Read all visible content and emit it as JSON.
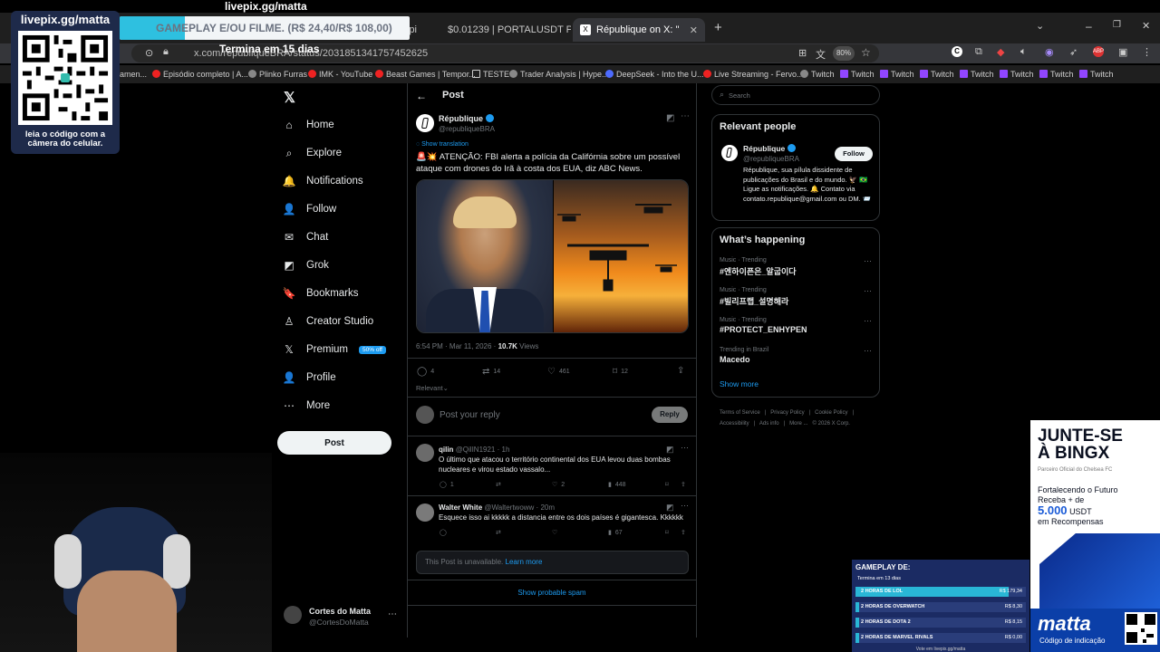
{
  "browser": {
    "tabs": [
      {
        "label": "Epi",
        "active": false
      },
      {
        "label": "$0.01239 | PORTALUSDT Perpé",
        "active": false
      },
      {
        "label": "République on X: \"",
        "active": true
      }
    ],
    "url": "x.com/republiqueBRA/status/2031851341757452625",
    "zoom": "80%",
    "bookmarks": [
      "amen...",
      "Episódio completo | A...",
      "Plinko Furras",
      "IMK - YouTube",
      "Beast Games | Tempor...",
      "TESTE",
      "Trader Analysis | Hype...",
      "DeepSeek - Into the U...",
      "Live Streaming - Fervo...",
      "Twitch",
      "Twitch",
      "Twitch",
      "Twitch",
      "Twitch",
      "Twitch",
      "Twitch",
      "Twitch"
    ]
  },
  "overlay": {
    "livepix_title": "livepix.gg/matta",
    "livepix_top": "livepix.gg/matta",
    "qr_caption_1": "leia o código com a",
    "qr_caption_2": "câmera do celular.",
    "goal_banner": "GAMEPLAY E/OU FILME. (R$ 24,40/R$ 108,00)",
    "goal_ends": "Termina em 15 dias",
    "gameplay_title": "GAMEPLAY DE:",
    "gameplay_ends": "Termina em 13 dias",
    "gameplay_rows": [
      {
        "label": "2 HORAS DE LOL",
        "value": "R$ 179,34",
        "fill": 0.9
      },
      {
        "label": "2 HORAS DE OVERWATCH",
        "value": "R$ 8,30",
        "fill": 0.02
      },
      {
        "label": "2 HORAS DE DOTA 2",
        "value": "R$ 8,15",
        "fill": 0.02
      },
      {
        "label": "2 HORAS DE MARVEL RIVALS",
        "value": "R$ 0,00",
        "fill": 0.0
      }
    ],
    "gameplay_footer": "Vote em livepix.gg/matta",
    "bingx_title_1": "JUNTE-SE",
    "bingx_title_2": "À BINGX",
    "bingx_sub": "Parceiro Oficial do Chelsea FC",
    "bingx_line1": "Fortalecendo o Futuro",
    "bingx_line2": "Receba + de",
    "bingx_amount": "5.000",
    "bingx_unit": "USDT",
    "bingx_line3": "em Recompensas",
    "matta_logo": "matta",
    "matta_sub": "Código de indicação"
  },
  "sidebar": {
    "items": [
      {
        "label": "Home",
        "icon": "home-icon",
        "glyph": "⌂"
      },
      {
        "label": "Explore",
        "icon": "search-icon",
        "glyph": "⌕"
      },
      {
        "label": "Notifications",
        "icon": "bell-icon",
        "glyph": "🔔"
      },
      {
        "label": "Follow",
        "icon": "person-plus-icon",
        "glyph": "👤"
      },
      {
        "label": "Chat",
        "icon": "mail-icon",
        "glyph": "✉"
      },
      {
        "label": "Grok",
        "icon": "grok-icon",
        "glyph": "◩"
      },
      {
        "label": "Bookmarks",
        "icon": "bookmark-icon",
        "glyph": "🔖"
      },
      {
        "label": "Creator Studio",
        "icon": "creator-icon",
        "glyph": "♙"
      },
      {
        "label": "Premium",
        "icon": "x-logo-icon",
        "glyph": "𝕏",
        "badge": "50% off"
      },
      {
        "label": "Profile",
        "icon": "profile-icon",
        "glyph": "👤"
      },
      {
        "label": "More",
        "icon": "more-circle-icon",
        "glyph": "⋯"
      }
    ],
    "post_button": "Post",
    "account_name": "Cortes do Matta",
    "account_handle": "@CortesDoMatta"
  },
  "post": {
    "header": "Post",
    "author": "République",
    "handle": "@republiqueBRA",
    "show_translation": "Show translation",
    "text": "🚨💥 ATENÇÃO: FBI alerta a polícia da Califórnia sobre um possível ataque com drones do Irã à costa dos EUA, diz ABC News.",
    "time": "6:54 PM · Mar 11, 2026 ·",
    "views": "10.7K",
    "views_label": "Views",
    "replies": "4",
    "reposts": "14",
    "likes": "461",
    "bookmarks": "12",
    "relevant": "Relevant",
    "reply_placeholder": "Post your reply",
    "reply_button": "Reply"
  },
  "replies": [
    {
      "name": "qilin",
      "handle": "@QilIN1921 · 1h",
      "text": "O último que atacou o território continental dos EUA levou duas bombas nucleares e virou estado vassalo...",
      "r": "1",
      "rt": "",
      "l": "2",
      "v": "448"
    },
    {
      "name": "Walter White",
      "handle": "@Waltertwoww · 20m",
      "text": "Esquece isso ai kkkkk a distancia entre os dois países é gigantesca. Kkkkkk",
      "r": "",
      "rt": "",
      "l": "",
      "v": "67"
    }
  ],
  "unavailable": {
    "text": "This Post is unavailable.",
    "link": "Learn more"
  },
  "show_spam": "Show probable spam",
  "right": {
    "search_placeholder": "Search",
    "relevant_title": "Relevant people",
    "person_name": "République",
    "person_handle": "@republiqueBRA",
    "follow": "Follow",
    "bio": "République, sua pílula dissidente de publicações do Brasil e do mundo. 🦅 🇧🇷 Ligue as notificações. 🔔 Contato via contato.republique@gmail.com ou DM. 📨",
    "happening_title": "What’s happening",
    "trends": [
      {
        "cat": "Music · Trending",
        "t": "#엔하이픈은_알굽이다"
      },
      {
        "cat": "Music · Trending",
        "t": "#빌리프랩_설명해라"
      },
      {
        "cat": "Music · Trending",
        "t": "#PROTECT_ENHYPEN"
      },
      {
        "cat": "Trending in Brazil",
        "t": "Macedo"
      }
    ],
    "show_more": "Show more",
    "footer": [
      "Terms of Service",
      "Privacy Policy",
      "Cookie Policy",
      "Accessibility",
      "Ads info",
      "More ...",
      "© 2026 X Corp."
    ]
  },
  "colors": {
    "x_blue": "#1d9bf0",
    "bg": "#000000",
    "border": "#2f3336",
    "overlay_cyan": "#29b6d6"
  }
}
